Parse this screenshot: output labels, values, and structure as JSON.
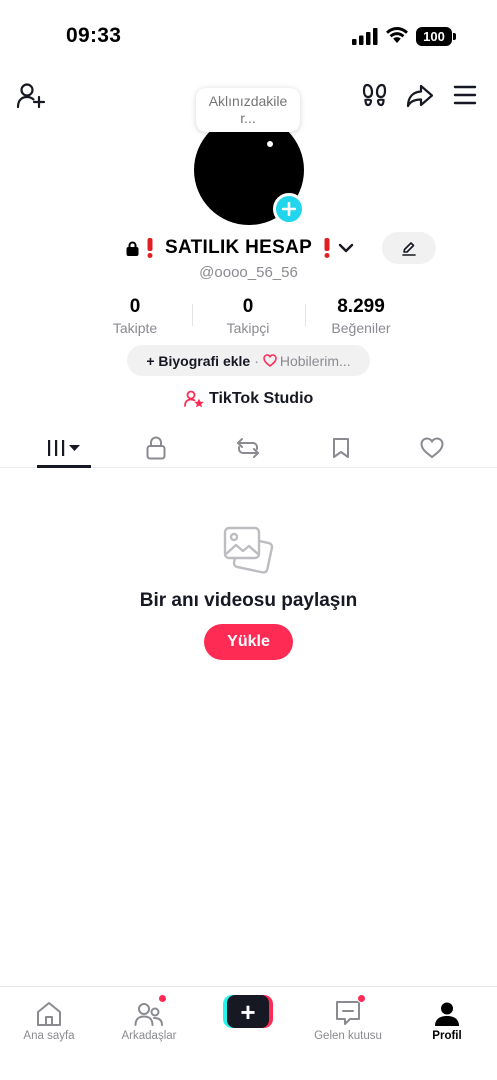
{
  "status_bar": {
    "time": "09:33",
    "battery": "100"
  },
  "profile": {
    "note_bubble": "Aklınızdakile r...",
    "display_name": "SATILIK HESAP",
    "username": "@oooo_56_56",
    "stats": [
      {
        "value": "0",
        "label": "Takipte"
      },
      {
        "value": "0",
        "label": "Takipçi"
      },
      {
        "value": "8.299",
        "label": "Beğeniler"
      }
    ],
    "bio_add_label": "+ Biyografi ekle",
    "bio_separator": "·",
    "hobbies_label": "Hobilerim...",
    "studio_label": "TikTok Studio"
  },
  "tabs": [
    {
      "icon": "grid-icon",
      "active": true
    },
    {
      "icon": "lock-icon",
      "active": false
    },
    {
      "icon": "repost-icon",
      "active": false
    },
    {
      "icon": "bookmark-icon",
      "active": false
    },
    {
      "icon": "heart-icon",
      "active": false
    }
  ],
  "empty_state": {
    "title": "Bir anı videosu paylaşın",
    "upload_label": "Yükle"
  },
  "bottom_nav": {
    "home": "Ana sayfa",
    "friends": "Arkadaşlar",
    "create": "+",
    "inbox": "Gelen kutusu",
    "profile": "Profil"
  },
  "colors": {
    "accent": "#fe2c55",
    "cyan": "#25f4ee",
    "add_badge": "#20d5ec",
    "text": "#161823",
    "muted": "#8a8b91"
  }
}
